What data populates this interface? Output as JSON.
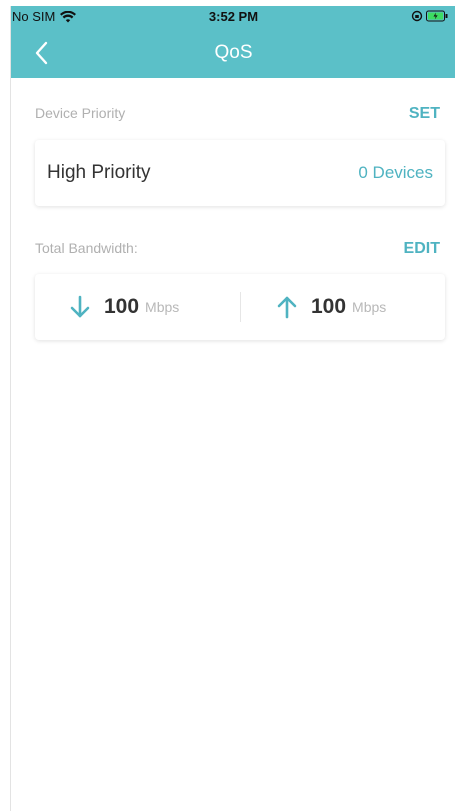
{
  "status_bar": {
    "carrier": "No SIM",
    "time": "3:52 PM"
  },
  "nav": {
    "title": "QoS",
    "back_icon": "chevron-left-icon"
  },
  "device_priority": {
    "label": "Device Priority",
    "action": "SET",
    "item_name": "High Priority",
    "item_count": "0 Devices"
  },
  "bandwidth": {
    "label": "Total Bandwidth:",
    "action": "EDIT",
    "download_value": "100",
    "download_unit": "Mbps",
    "upload_value": "100",
    "upload_unit": "Mbps"
  },
  "colors": {
    "accent": "#5bc0c8",
    "accent_text": "#4fb3c1"
  }
}
